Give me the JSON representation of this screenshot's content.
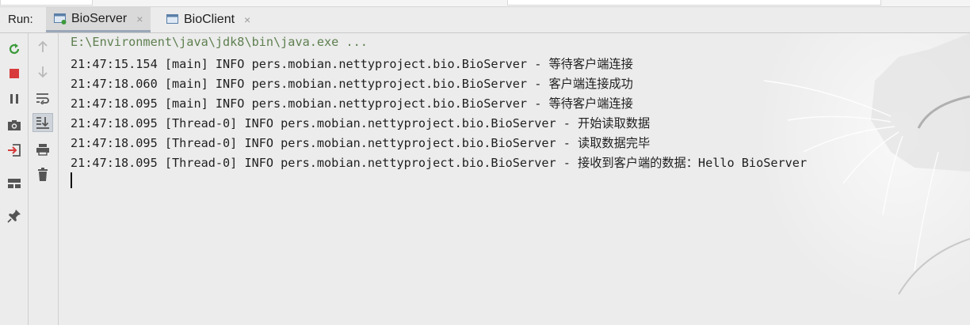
{
  "run_panel": {
    "label": "Run:",
    "tabs": [
      {
        "name": "BioServer",
        "active": true
      },
      {
        "name": "BioClient",
        "active": false
      }
    ],
    "close_glyph": "×"
  },
  "left_toolbar": [
    {
      "icon": "rerun-icon",
      "color": "#3c9a3c"
    },
    {
      "icon": "stop-icon",
      "color": "#d83b3b"
    },
    {
      "icon": "pause-icon",
      "color": "#555555"
    },
    {
      "icon": "camera-icon",
      "color": "#555555"
    },
    {
      "icon": "login-icon",
      "color": "#d83b3b"
    },
    {
      "icon": "layout-icon",
      "color": "#555555"
    },
    {
      "icon": "pin-icon",
      "color": "#555555"
    }
  ],
  "second_toolbar": [
    {
      "icon": "arrow-up-icon"
    },
    {
      "icon": "arrow-down-icon"
    },
    {
      "icon": "soft-wrap-icon"
    },
    {
      "icon": "scroll-to-end-icon",
      "selected": true
    },
    {
      "icon": "print-icon"
    },
    {
      "icon": "trash-icon"
    }
  ],
  "console": {
    "command": "E:\\Environment\\java\\jdk8\\bin\\java.exe ...",
    "lines": [
      "21:47:15.154 [main] INFO pers.mobian.nettyproject.bio.BioServer - 等待客户端连接",
      "21:47:18.060 [main] INFO pers.mobian.nettyproject.bio.BioServer - 客户端连接成功",
      "21:47:18.095 [main] INFO pers.mobian.nettyproject.bio.BioServer - 等待客户端连接",
      "21:47:18.095 [Thread-0] INFO pers.mobian.nettyproject.bio.BioServer - 开始读取数据",
      "21:47:18.095 [Thread-0] INFO pers.mobian.nettyproject.bio.BioServer - 读取数据完毕",
      "21:47:18.095 [Thread-0] INFO pers.mobian.nettyproject.bio.BioServer - 接收到客户端的数据：Hello BioServer"
    ]
  }
}
